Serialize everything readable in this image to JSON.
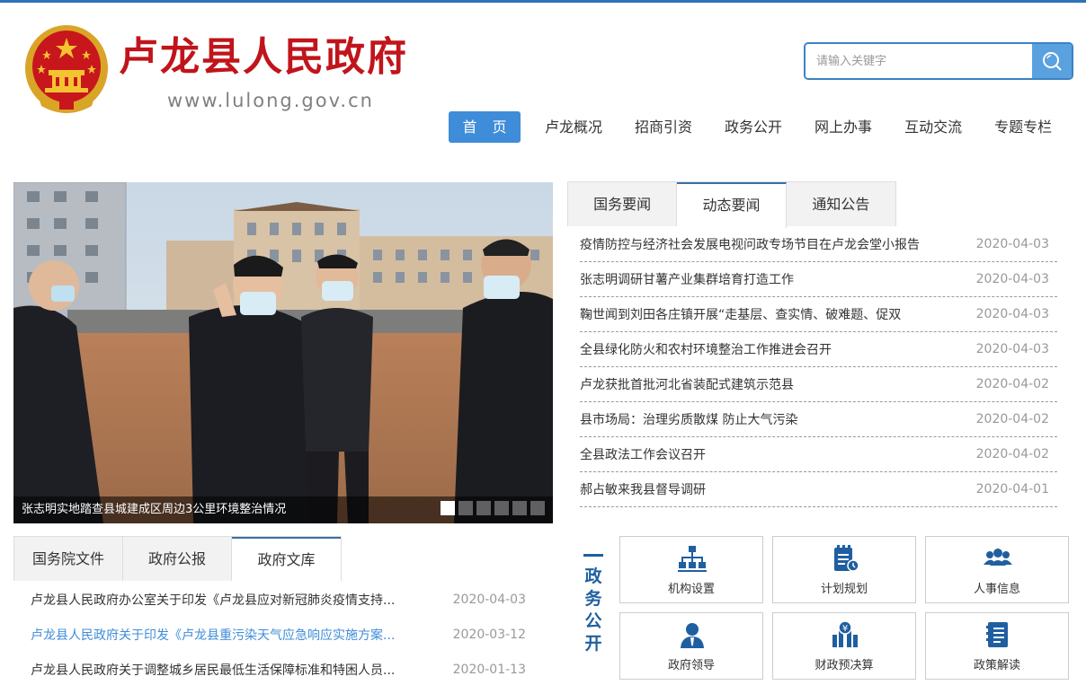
{
  "header": {
    "title": "卢龙县人民政府",
    "url": "www.lulong.gov.cn",
    "search_placeholder": "请输入关键字"
  },
  "nav": [
    "首 页",
    "卢龙概况",
    "招商引资",
    "政务公开",
    "网上办事",
    "互动交流",
    "专题专栏"
  ],
  "slider": {
    "caption": "张志明实地踏查县城建成区周边3公里环境整治情况",
    "dot_count": 6,
    "active_dot": 1
  },
  "news": {
    "tabs": [
      "国务要闻",
      "动态要闻",
      "通知公告"
    ],
    "active_tab": 1,
    "items": [
      {
        "title": "疫情防控与经济社会发展电视问政专场节目在卢龙会堂小报告",
        "date": "2020-04-03"
      },
      {
        "title": "张志明调研甘薯产业集群培育打造工作",
        "date": "2020-04-03"
      },
      {
        "title": "鞠世闻到刘田各庄镇开展“走基层、查实情、破难题、促双",
        "date": "2020-04-03"
      },
      {
        "title": "全县绿化防火和农村环境整治工作推进会召开",
        "date": "2020-04-03"
      },
      {
        "title": "卢龙获批首批河北省装配式建筑示范县",
        "date": "2020-04-02"
      },
      {
        "title": "县市场局：治理劣质散煤 防止大气污染",
        "date": "2020-04-02"
      },
      {
        "title": "全县政法工作会议召开",
        "date": "2020-04-02"
      },
      {
        "title": "郝占敏来我县督导调研",
        "date": "2020-04-01"
      }
    ]
  },
  "docs": {
    "tabs": [
      "国务院文件",
      "政府公报",
      "政府文库"
    ],
    "active_tab": 2,
    "items": [
      {
        "title": "卢龙县人民政府办公室关于印发《卢龙县应对新冠肺炎疫情支持...",
        "date": "2020-04-03"
      },
      {
        "title": "卢龙县人民政府关于印发《卢龙县重污染天气应急响应实施方案...",
        "date": "2020-03-12"
      },
      {
        "title": "卢龙县人民政府关于调整城乡居民最低生活保障标准和特困人员...",
        "date": "2020-01-13"
      }
    ]
  },
  "gov": {
    "label": "政务公开",
    "items": [
      {
        "label": "机构设置",
        "icon": "org-chart-icon"
      },
      {
        "label": "计划规划",
        "icon": "planning-icon"
      },
      {
        "label": "人事信息",
        "icon": "personnel-icon"
      },
      {
        "label": "政府领导",
        "icon": "leader-icon"
      },
      {
        "label": "财政预决算",
        "icon": "finance-icon"
      },
      {
        "label": "政策解读",
        "icon": "policy-book-icon"
      }
    ]
  },
  "colors": {
    "title_red": "#c1141b",
    "accent_blue": "#3f8cd8",
    "gov_blue": "#1f5fa0"
  }
}
